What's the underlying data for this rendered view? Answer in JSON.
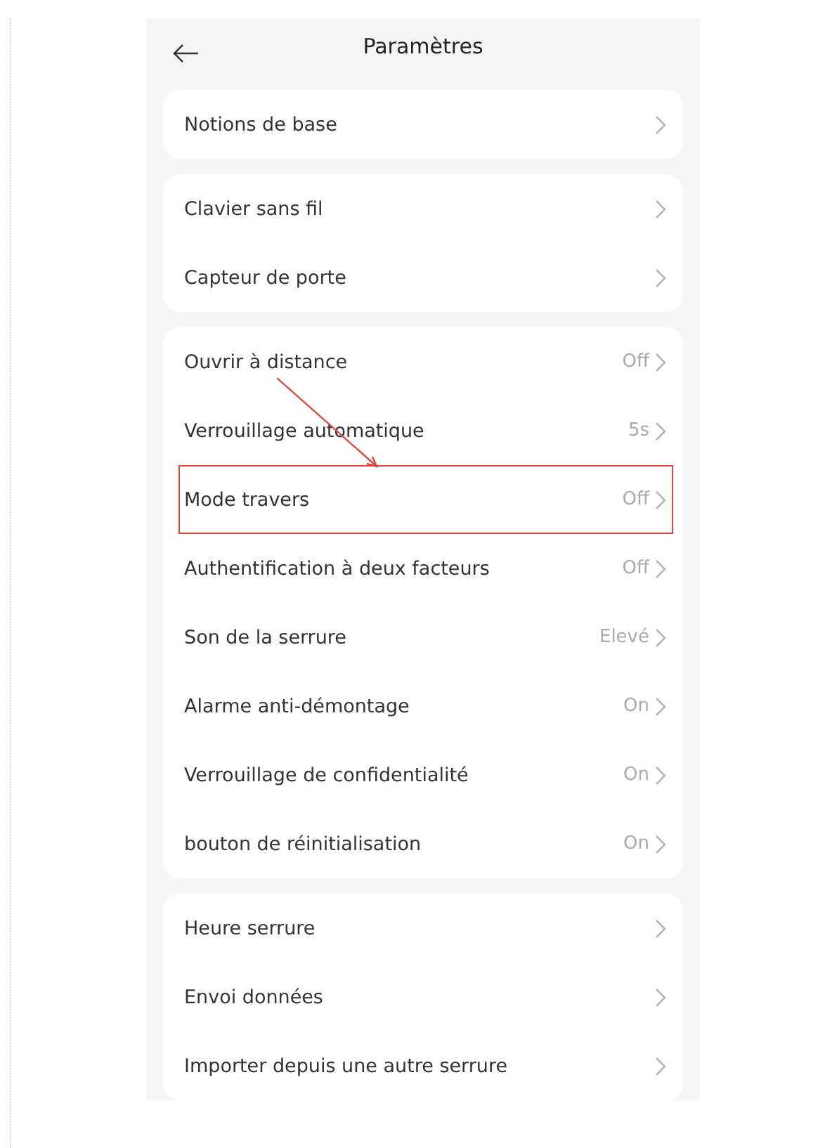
{
  "header": {
    "title": "Paramètres"
  },
  "groups": [
    {
      "rows": [
        {
          "label": "Notions de base",
          "highlighted": false
        }
      ]
    },
    {
      "rows": [
        {
          "label": "Clavier sans fil",
          "highlighted": false
        },
        {
          "label": "Capteur de porte",
          "highlighted": false
        }
      ]
    },
    {
      "rows": [
        {
          "label": "Ouvrir à distance",
          "value": "Off",
          "highlighted": false
        },
        {
          "label": "Verrouillage automatique",
          "value": "5s",
          "highlighted": false
        },
        {
          "label": "Mode travers",
          "value": "Off",
          "highlighted": true
        },
        {
          "label": "Authentification à deux facteurs",
          "value": "Off",
          "highlighted": false
        },
        {
          "label": "Son de la serrure",
          "value": "Elevé",
          "highlighted": false
        },
        {
          "label": "Alarme anti-démontage",
          "value": "On",
          "highlighted": false
        },
        {
          "label": "Verrouillage de confidentialité",
          "value": "On",
          "highlighted": false
        },
        {
          "label": "bouton de réinitialisation",
          "value": "On",
          "highlighted": false
        }
      ]
    },
    {
      "rows": [
        {
          "label": "Heure serrure",
          "highlighted": false
        },
        {
          "label": "Envoi données",
          "highlighted": false
        },
        {
          "label": "Importer depuis une autre serrure",
          "highlighted": false
        }
      ]
    }
  ]
}
